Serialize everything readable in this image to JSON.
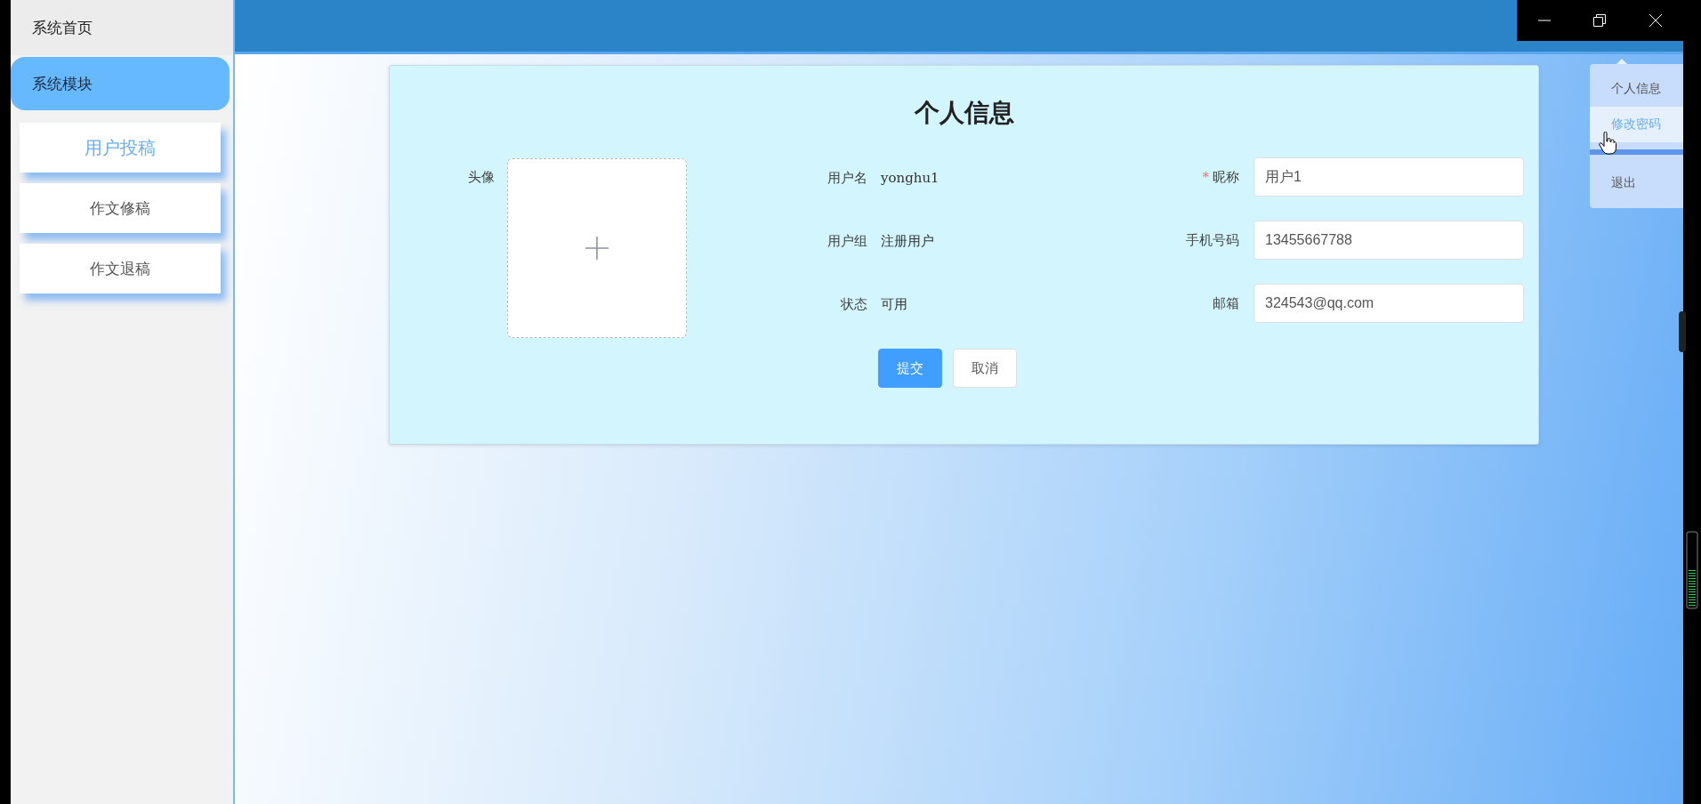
{
  "sidebar": {
    "items": [
      {
        "label": "系统首页",
        "kind": "link"
      },
      {
        "label": "系统模块",
        "kind": "group",
        "children": [
          {
            "label": "用户投稿",
            "selected": true
          },
          {
            "label": "作文修稿",
            "selected": false
          },
          {
            "label": "作文退稿",
            "selected": false
          }
        ]
      }
    ]
  },
  "user_menu": {
    "items": [
      {
        "label": "个人信息",
        "hovered": false
      },
      {
        "label": "修改密码",
        "hovered": true
      },
      {
        "label": "退出",
        "hovered": false
      }
    ]
  },
  "form": {
    "title": "个人信息",
    "avatar": {
      "label": "头像"
    },
    "info": [
      {
        "label": "用户名",
        "value": "yonghu1"
      },
      {
        "label": "用户组",
        "value": "注册用户"
      },
      {
        "label": "状态",
        "value": "可用"
      }
    ],
    "fields": [
      {
        "label": "昵称",
        "value": "用户1",
        "mark": "*"
      },
      {
        "label": "手机号码",
        "value": "13455667788"
      },
      {
        "label": "邮箱",
        "value": "324543@qq.com"
      }
    ],
    "buttons": [
      {
        "label": "提交",
        "kind": "primary"
      },
      {
        "label": "取消",
        "kind": "default"
      }
    ]
  }
}
